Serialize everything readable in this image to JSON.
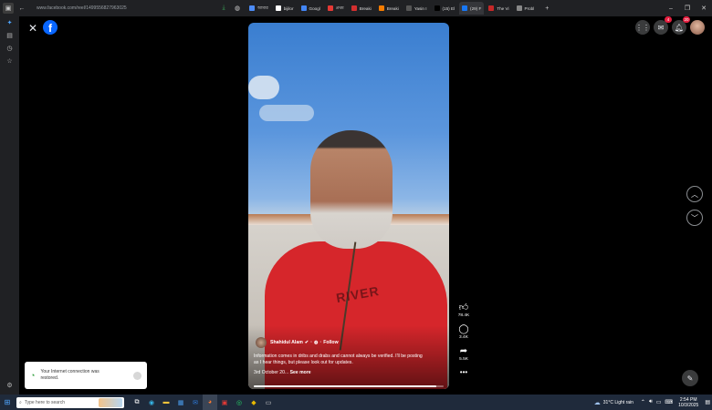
{
  "browser": {
    "url": "www.facebook.com/reel/1499556827963025",
    "tabs": [
      {
        "label": "আমার",
        "color": "#4c8bf5",
        "active": false
      },
      {
        "label": "bijilor",
        "color": "#ffffff",
        "active": false
      },
      {
        "label": "Googl",
        "color": "#4285f4",
        "active": false
      },
      {
        "label": "প্রথম",
        "color": "#e53935",
        "active": false
      },
      {
        "label": "Breaki",
        "color": "#d32f2f",
        "active": false
      },
      {
        "label": "Breaki",
        "color": "#f57c00",
        "active": false
      },
      {
        "label": "Yasin I",
        "color": "#555555",
        "active": false
      },
      {
        "label": "(15) El",
        "color": "#000000",
        "active": false
      },
      {
        "label": "(29) F",
        "color": "#1877f2",
        "active": true
      },
      {
        "label": "The Vi",
        "color": "#c62828",
        "active": false
      },
      {
        "label": "Probl",
        "color": "#888888",
        "active": false
      }
    ]
  },
  "reel": {
    "author": "Shahidul Alam",
    "follow_label": "Follow",
    "caption": "Information comes in dribs and drabs and cannot always be verified. I'll be posting as I hear things, but please look out for updates.",
    "date": "3rd October 20...",
    "see_more": "See more",
    "progress": 0.96,
    "shirt_print": "RIVER"
  },
  "actions": {
    "likes": "78.4K",
    "comments": "3.4K",
    "shares": "5.5K"
  },
  "header": {
    "messenger_badge": "4",
    "notif_badge": "20"
  },
  "toast": {
    "message": "Your Internet connection was restored."
  },
  "taskbar": {
    "search_placeholder": "Type here to search",
    "weather": "31°C  Light rain",
    "time": "2:54 PM",
    "date": "10/3/2025"
  },
  "colors": {
    "fb_blue": "#0866ff",
    "badge_red": "#e41e3f",
    "shirt_red": "#d6262b"
  }
}
